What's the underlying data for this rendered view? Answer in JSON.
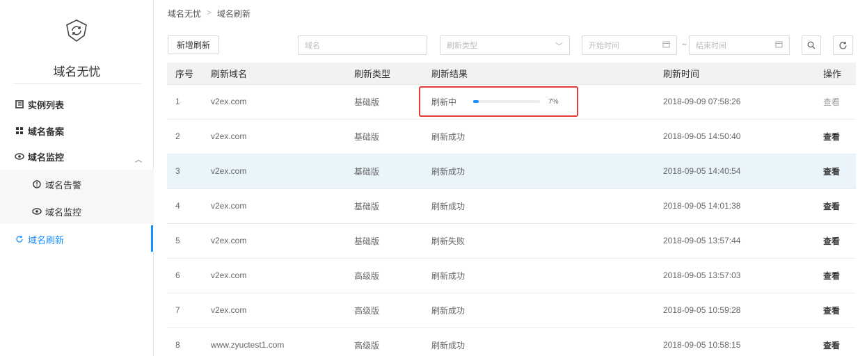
{
  "sidebar": {
    "app_name": "域名无忧",
    "items": [
      {
        "label": "实例列表",
        "icon": "list-icon"
      },
      {
        "label": "域名备案",
        "icon": "record-icon"
      },
      {
        "label": "域名监控",
        "icon": "eye-icon"
      },
      {
        "label": "域名告警",
        "icon": "alert-icon"
      },
      {
        "label": "域名监控",
        "icon": "eye-icon"
      },
      {
        "label": "域名刷新",
        "icon": "refresh-icon"
      }
    ],
    "active_color": "#1890ff"
  },
  "breadcrumb": {
    "root": "域名无忧",
    "separator": ">",
    "current": "域名刷新"
  },
  "toolbar": {
    "add_button_label": "新增刷新",
    "domain_placeholder": "域名",
    "type_placeholder": "刷新类型",
    "start_placeholder": "开始时间",
    "tilde": "~",
    "end_placeholder": "结束时间"
  },
  "table": {
    "headers": [
      "序号",
      "刷新域名",
      "刷新类型",
      "刷新结果",
      "刷新时间",
      "操作"
    ],
    "rows": [
      {
        "no": "1",
        "domain": "v2ex.com",
        "type": "基础版",
        "result": "刷新中",
        "time": "2018-09-09 07:58:26",
        "action": "查看",
        "progress": 7,
        "progress_label": "7%"
      },
      {
        "no": "2",
        "domain": "v2ex.com",
        "type": "基础版",
        "result": "刷新成功",
        "time": "2018-09-05 14:50:40",
        "action": "查看"
      },
      {
        "no": "3",
        "domain": "v2ex.com",
        "type": "基础版",
        "result": "刷新成功",
        "time": "2018-09-05 14:40:54",
        "action": "查看"
      },
      {
        "no": "4",
        "domain": "v2ex.com",
        "type": "基础版",
        "result": "刷新成功",
        "time": "2018-09-05 14:01:38",
        "action": "查看"
      },
      {
        "no": "5",
        "domain": "v2ex.com",
        "type": "基础版",
        "result": "刷新失败",
        "time": "2018-09-05 13:57:44",
        "action": "查看"
      },
      {
        "no": "6",
        "domain": "v2ex.com",
        "type": "高级版",
        "result": "刷新成功",
        "time": "2018-09-05 13:57:03",
        "action": "查看"
      },
      {
        "no": "7",
        "domain": "v2ex.com",
        "type": "高级版",
        "result": "刷新成功",
        "time": "2018-09-05 10:59:28",
        "action": "查看"
      },
      {
        "no": "8",
        "domain": "www.zyuctest1.com",
        "type": "高级版",
        "result": "刷新成功",
        "time": "2018-09-05 10:58:15",
        "action": "查看"
      }
    ],
    "highlight_row_color": "#eaf4fb",
    "callout_color": "#e53935"
  }
}
